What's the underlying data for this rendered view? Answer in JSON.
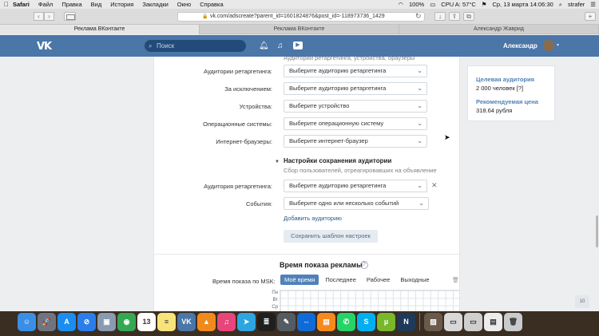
{
  "menubar": {
    "items": [
      "Safari",
      "Файл",
      "Правка",
      "Вид",
      "История",
      "Закладки",
      "Окно",
      "Справка"
    ],
    "battery": "100%",
    "cpu": "CPU A: 57°C",
    "clock": "Ср, 13 марта  14:06:30",
    "user": "strafer"
  },
  "browser": {
    "url": "vk.com/adscreate?parent_id=1601824876&post_id=-118973736_1429",
    "tabs": [
      "Реклама ВКонтакте",
      "Реклама ВКонтакте",
      "Александр Жаврид"
    ]
  },
  "vk_header": {
    "logo": "VK",
    "search_placeholder": "Поиск",
    "user_name": "Александр"
  },
  "form": {
    "top_fragment": "Аудитории ретаргетинга, устройства, браузеры",
    "rows": [
      {
        "label": "Аудитории ретаргетинга:",
        "value": "Выберите аудиторию ретаргетинга"
      },
      {
        "label": "За исключением:",
        "value": "Выберите аудиторию ретаргетинга"
      },
      {
        "label": "Устройства:",
        "value": "Выберите устройство"
      },
      {
        "label": "Операционные системы:",
        "value": "Выберите операционную систему"
      },
      {
        "label": "Интернет-браузеры:",
        "value": "Выберите интернет-браузер"
      }
    ],
    "save_section": {
      "title": "Настройки сохранения аудитории",
      "subtitle": "Сбор пользователей, отреагировавших на объявление",
      "rows": [
        {
          "label": "Аудитория ретаргетинга:",
          "value": "Выберите аудиторию ретаргетинга"
        },
        {
          "label": "События:",
          "value": "Выберите одно или несколько событий"
        }
      ],
      "add_link": "Добавить аудиторию",
      "save_template_button": "Сохранить шаблон настроек"
    },
    "time": {
      "title": "Время показа рекламы",
      "help": "?",
      "label": "Время показа по MSK:",
      "options": [
        "Моё время",
        "Последнее",
        "Рабочее",
        "Выходные"
      ],
      "active_option": "Моё время",
      "days": [
        "Пн",
        "Вт",
        "Ср"
      ]
    }
  },
  "side_panel": {
    "audience_title": "Целевая аудитория",
    "audience_value": "2 000 человек [?]",
    "price_title": "Рекомендуемая цена",
    "price_value": "318.64 рубля"
  },
  "page_badge": "10",
  "dock": {
    "apps": [
      {
        "icon": "finder-icon",
        "color": "#3a8ee6",
        "glyph": "☺"
      },
      {
        "icon": "launchpad-icon",
        "color": "#6f7580",
        "glyph": "🚀"
      },
      {
        "icon": "app-store-icon",
        "color": "#1b8df0",
        "glyph": "A"
      },
      {
        "icon": "safari-icon",
        "color": "#2b7de9",
        "glyph": "⊘"
      },
      {
        "icon": "preview-icon",
        "color": "#8a9bb0",
        "glyph": "▣"
      },
      {
        "icon": "chrome-icon",
        "color": "#34a853",
        "glyph": "◉"
      },
      {
        "icon": "calendar-icon",
        "color": "#ffffff",
        "glyph": "13"
      },
      {
        "icon": "notes-icon",
        "color": "#f7e37a",
        "glyph": "≡"
      },
      {
        "icon": "vk-icon",
        "color": "#4a76a8",
        "glyph": "VK"
      },
      {
        "icon": "vlc-icon",
        "color": "#f08a1c",
        "glyph": "▲"
      },
      {
        "icon": "music-icon",
        "color": "#e8457b",
        "glyph": "♫"
      },
      {
        "icon": "telegram-icon",
        "color": "#2ca5e0",
        "glyph": "➤"
      },
      {
        "icon": "terminal-icon",
        "color": "#1f1f1f",
        "glyph": "≣"
      },
      {
        "icon": "editor-icon",
        "color": "#555b63",
        "glyph": "✎"
      },
      {
        "icon": "teamviewer-icon",
        "color": "#0e6bd8",
        "glyph": "⇔"
      },
      {
        "icon": "books-icon",
        "color": "#f58a1f",
        "glyph": "▤"
      },
      {
        "icon": "whatsapp-icon",
        "color": "#25d366",
        "glyph": "✆"
      },
      {
        "icon": "skype-icon",
        "color": "#00aff0",
        "glyph": "S"
      },
      {
        "icon": "utorrent-icon",
        "color": "#78b82a",
        "glyph": "µ"
      },
      {
        "icon": "n-app-icon",
        "color": "#1e3a5a",
        "glyph": "N"
      }
    ],
    "right_apps": [
      {
        "icon": "photo-icon",
        "color": "#6b5a4a",
        "glyph": "▨"
      },
      {
        "icon": "window-icon",
        "color": "#d8d8d8",
        "glyph": "▭"
      },
      {
        "icon": "window2-icon",
        "color": "#cfcfcf",
        "glyph": "▭"
      },
      {
        "icon": "doc-icon",
        "color": "#ececec",
        "glyph": "▤"
      },
      {
        "icon": "trash-icon",
        "color": "#c9cbcd",
        "glyph": "🗑"
      }
    ]
  }
}
